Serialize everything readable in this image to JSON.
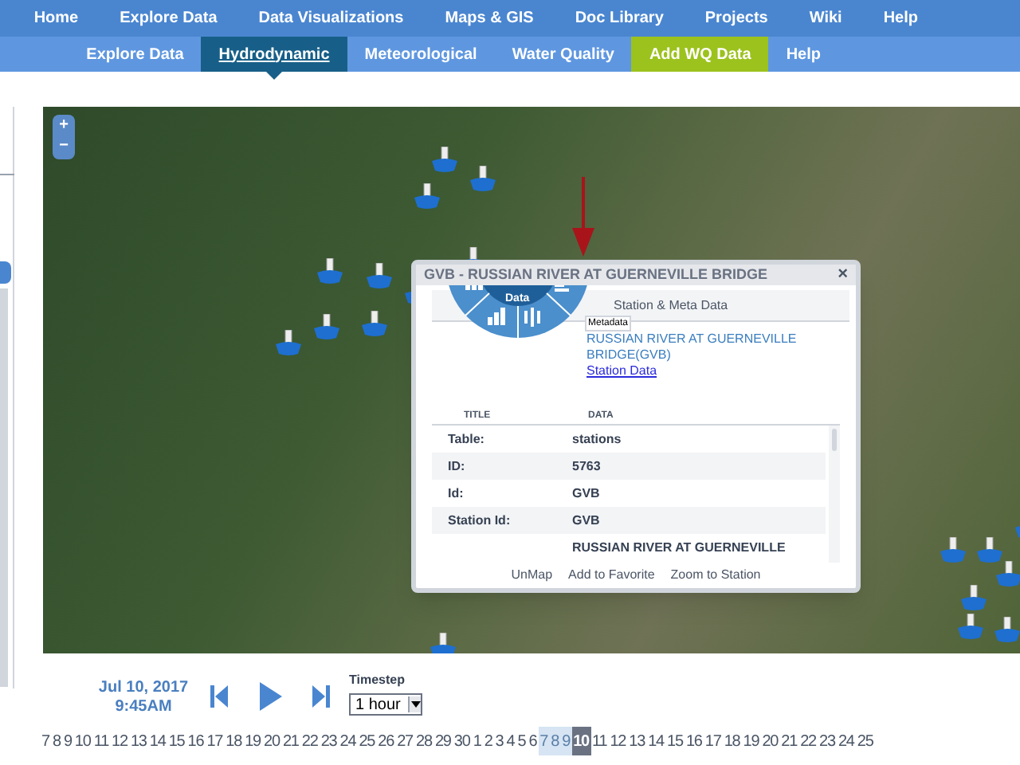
{
  "main_nav": [
    {
      "label": "Home"
    },
    {
      "label": "Explore Data"
    },
    {
      "label": "Data Visualizations"
    },
    {
      "label": "Maps & GIS"
    },
    {
      "label": "Doc Library"
    },
    {
      "label": "Projects"
    },
    {
      "label": "Wiki"
    },
    {
      "label": "Help"
    }
  ],
  "sub_nav": [
    {
      "label": "Explore Data",
      "selected": false,
      "kind": "plain"
    },
    {
      "label": "Hydrodynamic",
      "selected": true,
      "kind": "plain"
    },
    {
      "label": "Meteorological",
      "selected": false,
      "kind": "plain"
    },
    {
      "label": "Water Quality",
      "selected": false,
      "kind": "plain"
    },
    {
      "label": "Add WQ Data",
      "selected": false,
      "kind": "accent"
    },
    {
      "label": "Help",
      "selected": false,
      "kind": "plain"
    }
  ],
  "map": {
    "zoom_in": "+",
    "zoom_out": "−"
  },
  "popup": {
    "title": "GVB - RUSSIAN RIVER AT GUERNEVILLE BRIDGE",
    "close": "×",
    "radial_center": "Data",
    "tooltip": "Metadata",
    "section": "Station & Meta Data",
    "station_name": "RUSSIAN RIVER AT GUERNEVILLE BRIDGE(GVB)",
    "station_link": "Station Data",
    "columns": [
      "TITLE",
      "DATA"
    ],
    "rows": [
      {
        "title": "Table:",
        "data": "stations"
      },
      {
        "title": "ID:",
        "data": "5763"
      },
      {
        "title": "Id:",
        "data": "GVB"
      },
      {
        "title": "Station Id:",
        "data": "GVB"
      },
      {
        "data": "RUSSIAN RIVER AT GUERNEVILLE"
      }
    ],
    "actions": [
      "UnMap",
      "Add to Favorite",
      "Zoom to Station"
    ]
  },
  "player": {
    "date": "Jul 10, 2017",
    "time": "9:45AM",
    "timestep_label": "Timestep",
    "timestep": "1 hour"
  },
  "timeline": [
    {
      "label": "7",
      "highlighted": false,
      "selected": false
    },
    {
      "label": "8",
      "highlighted": false,
      "selected": false
    },
    {
      "label": "9",
      "highlighted": false,
      "selected": false
    },
    {
      "label": "10",
      "highlighted": false,
      "selected": false
    },
    {
      "label": "11",
      "highlighted": false,
      "selected": false
    },
    {
      "label": "12",
      "highlighted": false,
      "selected": false
    },
    {
      "label": "13",
      "highlighted": false,
      "selected": false
    },
    {
      "label": "14",
      "highlighted": false,
      "selected": false
    },
    {
      "label": "15",
      "highlighted": false,
      "selected": false
    },
    {
      "label": "16",
      "highlighted": false,
      "selected": false
    },
    {
      "label": "17",
      "highlighted": false,
      "selected": false
    },
    {
      "label": "18",
      "highlighted": false,
      "selected": false
    },
    {
      "label": "19",
      "highlighted": false,
      "selected": false
    },
    {
      "label": "20",
      "highlighted": false,
      "selected": false
    },
    {
      "label": "21",
      "highlighted": false,
      "selected": false
    },
    {
      "label": "22",
      "highlighted": false,
      "selected": false
    },
    {
      "label": "23",
      "highlighted": false,
      "selected": false
    },
    {
      "label": "24",
      "highlighted": false,
      "selected": false
    },
    {
      "label": "25",
      "highlighted": false,
      "selected": false
    },
    {
      "label": "26",
      "highlighted": false,
      "selected": false
    },
    {
      "label": "27",
      "highlighted": false,
      "selected": false
    },
    {
      "label": "28",
      "highlighted": false,
      "selected": false
    },
    {
      "label": "29",
      "highlighted": false,
      "selected": false
    },
    {
      "label": "30",
      "highlighted": false,
      "selected": false
    },
    {
      "label": "1",
      "highlighted": false,
      "selected": false
    },
    {
      "label": "2",
      "highlighted": false,
      "selected": false
    },
    {
      "label": "3",
      "highlighted": false,
      "selected": false
    },
    {
      "label": "4",
      "highlighted": false,
      "selected": false
    },
    {
      "label": "5",
      "highlighted": false,
      "selected": false
    },
    {
      "label": "6",
      "highlighted": false,
      "selected": false
    },
    {
      "label": "7",
      "highlighted": true,
      "selected": false
    },
    {
      "label": "8",
      "highlighted": true,
      "selected": false
    },
    {
      "label": "9",
      "highlighted": true,
      "selected": false
    },
    {
      "label": "10",
      "highlighted": false,
      "selected": true
    },
    {
      "label": "11",
      "highlighted": false,
      "selected": false
    },
    {
      "label": "12",
      "highlighted": false,
      "selected": false
    },
    {
      "label": "13",
      "highlighted": false,
      "selected": false
    },
    {
      "label": "14",
      "highlighted": false,
      "selected": false
    },
    {
      "label": "15",
      "highlighted": false,
      "selected": false
    },
    {
      "label": "16",
      "highlighted": false,
      "selected": false
    },
    {
      "label": "17",
      "highlighted": false,
      "selected": false
    },
    {
      "label": "18",
      "highlighted": false,
      "selected": false
    },
    {
      "label": "19",
      "highlighted": false,
      "selected": false
    },
    {
      "label": "20",
      "highlighted": false,
      "selected": false
    },
    {
      "label": "21",
      "highlighted": false,
      "selected": false
    },
    {
      "label": "22",
      "highlighted": false,
      "selected": false
    },
    {
      "label": "23",
      "highlighted": false,
      "selected": false
    },
    {
      "label": "24",
      "highlighted": false,
      "selected": false
    },
    {
      "label": "25",
      "highlighted": false,
      "selected": false
    }
  ]
}
